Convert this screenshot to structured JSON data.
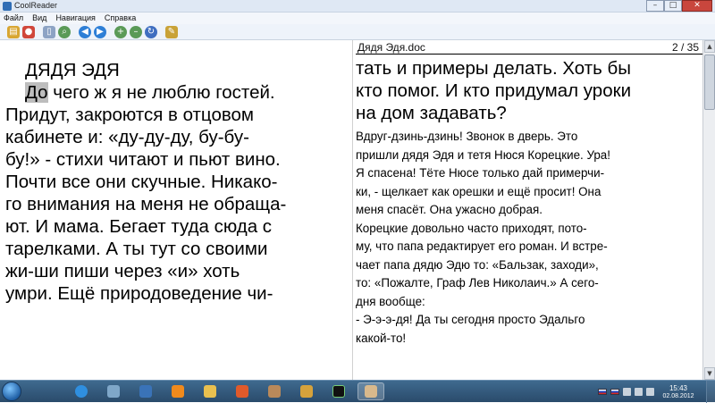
{
  "window": {
    "title": "CoolReader"
  },
  "menu": [
    "Файл",
    "Вид",
    "Навигация",
    "Справка"
  ],
  "toolbar": {
    "icons": [
      "open-file-icon",
      "recent-books-icon",
      "page-view-icon",
      "search-icon",
      "back-icon",
      "forward-icon",
      "zoom-in-icon",
      "zoom-out-icon",
      "rotate-icon",
      "settings-icon"
    ]
  },
  "header": {
    "book_title": "Дядя Эдя.doc",
    "page_indicator": "2 / 35"
  },
  "left_page": {
    "chapter": "ДЯДЯ ЭДЯ",
    "selected_word": "До",
    "first_line_rest": " чего ж я не люблю гостей.",
    "lines": [
      "Придут, закроются в отцовом",
      "кабинете и: «ду-ду-ду, бу-бу-",
      "бу!» - стихи читают и пьют вино.",
      "Почти все они скучные. Никако-",
      "го внимания на меня не обраща-",
      "ют. И мама. Бегает туда сюда с",
      "тарелками. А ты тут со своими",
      "жи-ши пиши через «и» хоть",
      "умри. Ещё природоведение чи-"
    ]
  },
  "right_page": {
    "big_lines": [
      "тать и примеры делать. Хоть бы",
      "кто помог. И кто придумал уроки",
      "на дом задавать?"
    ],
    "small_lines": [
      "     Вдруг-дзинь-дзинь! Звонок в дверь. Это",
      "пришли дядя Эдя и тетя Нюся Корецкие. Ура!",
      "Я спасена! Тёте Нюсе только дай примерчи-",
      "ки, - щелкает как орешки и ещё просит! Она",
      "меня спасёт. Она ужасно добрая.",
      "     Корецкие довольно часто приходят, пото-",
      "му, что папа редактирует его роман. И встре-",
      "чает папа дядю Эдю то: «Бальзак, заходи»,",
      "то: «Пожалте, Граф Лев Николаич.» А сего-",
      "дня вообще:",
      "     - Э-э-э-дя! Да ты сегодня просто Эдальго",
      "какой-то!"
    ]
  },
  "taskbar": {
    "clock_time": "15:43",
    "clock_date": "02.08.2012",
    "apps": [
      "ie-icon",
      "explorer-icon",
      "media-player-icon",
      "odnoklassniki-icon",
      "folder-icon",
      "video-icon",
      "tools-icon",
      "game-icon",
      "cheat-icon",
      "coolreader-icon"
    ]
  }
}
